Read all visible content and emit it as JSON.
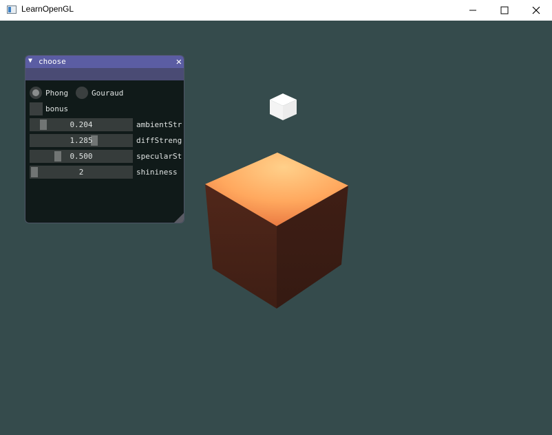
{
  "window": {
    "title": "LearnOpenGL",
    "app_icon": "window-icon",
    "controls": [
      "minimize-icon",
      "maximize-icon",
      "close-icon"
    ],
    "background_color": "#354b4c"
  },
  "panel": {
    "title": "choose",
    "collapse_glyph": "▼",
    "close_glyph": "✕",
    "shading": {
      "options": [
        {
          "label": "Phong",
          "selected": true
        },
        {
          "label": "Gouraud",
          "selected": false
        }
      ]
    },
    "bonus": {
      "label": "bonus",
      "checked": false
    },
    "sliders": [
      {
        "label": "ambientStr",
        "value": "0.204",
        "fraction": 0.1
      },
      {
        "label": "diffStreng",
        "value": "1.285",
        "fraction": 0.64
      },
      {
        "label": "specularSt",
        "value": "0.500",
        "fraction": 0.25
      },
      {
        "label": "shininess",
        "value": "2",
        "fraction": 0.0
      }
    ]
  },
  "scene": {
    "light_cube_color": "#ffffff",
    "object_colors": {
      "top": "#ffb36a",
      "left": "#4a2418",
      "right": "#3a1c14"
    }
  }
}
